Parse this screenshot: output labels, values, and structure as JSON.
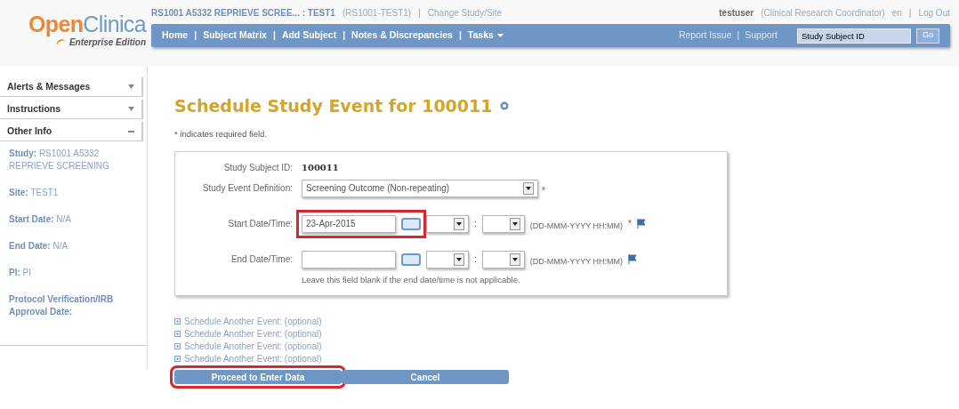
{
  "logo": {
    "part_1": "Open",
    "part_2": "Clinica",
    "edition": "Enterprise Edition"
  },
  "study_line": {
    "study": "RS1001 A5332 REPRIEVE SCREE... : TEST1",
    "site_code": "(RS1001-TEST1)",
    "separator": "|",
    "change_link": "Change Study/Site"
  },
  "user_line": {
    "user": "testuser",
    "role": "(Clinical Research Coordinator)",
    "language": "en",
    "separator": "|",
    "logout": "Log Out"
  },
  "nav": {
    "items": [
      {
        "label": "Home",
        "dropdown": false
      },
      {
        "label": "Subject Matrix",
        "dropdown": false
      },
      {
        "label": "Add Subject",
        "dropdown": false
      },
      {
        "label": "Notes & Discrepancies",
        "dropdown": false
      },
      {
        "label": "Tasks",
        "dropdown": true
      }
    ],
    "separator": "|",
    "report_issue": "Report Issue",
    "support": "Support",
    "search": {
      "value": "Study Subject ID"
    },
    "go_button": "Go"
  },
  "sidebar": {
    "panels": [
      {
        "title": "Alerts & Messages",
        "expanded": false
      },
      {
        "title": "Instructions",
        "expanded": false
      },
      {
        "title": "Other Info",
        "expanded": true
      }
    ],
    "info": [
      {
        "label": "Study:",
        "value": "RS1001 A5332 REPRIEVE SCREENING"
      },
      {
        "label": "Site:",
        "value": "TEST1"
      },
      {
        "label": "Start Date:",
        "value": "N/A"
      },
      {
        "label": "End Date:",
        "value": "N/A"
      },
      {
        "label": "PI:",
        "value": "PI"
      },
      {
        "label": "Protocol Verification/IRB Approval Date:"
      }
    ]
  },
  "page": {
    "title": "Schedule Study Event for 100011",
    "required_note": "* indicates required field."
  },
  "form": {
    "subject_id": {
      "label": "Study Subject ID:",
      "value": "100011"
    },
    "event_definition": {
      "label": "Study Event Definition:",
      "value": "Screening Outcome (Non-repeating)",
      "required": "*"
    },
    "dates": [
      {
        "label": "Start Date/Time:",
        "value": "23-Apr-2015",
        "format": "(DD-MMM-YYYY HH:MM)",
        "required": "*",
        "highlighted": true,
        "colon": ":"
      },
      {
        "label": "End Date/Time:",
        "format": "(DD-MMM-YYYY HH:MM)",
        "highlighted": false,
        "colon": ":"
      }
    ],
    "end_hint": "Leave this field blank if the end date/time is not applicable."
  },
  "other_events": [
    "Schedule Another Event: (optional)",
    "Schedule Another Event: (optional)",
    "Schedule Another Event: (optional)",
    "Schedule Another Event: (optional)"
  ],
  "buttons": [
    {
      "label": "Proceed to Enter Data",
      "highlighted": true
    },
    {
      "label": "Cancel",
      "highlighted": false
    }
  ]
}
